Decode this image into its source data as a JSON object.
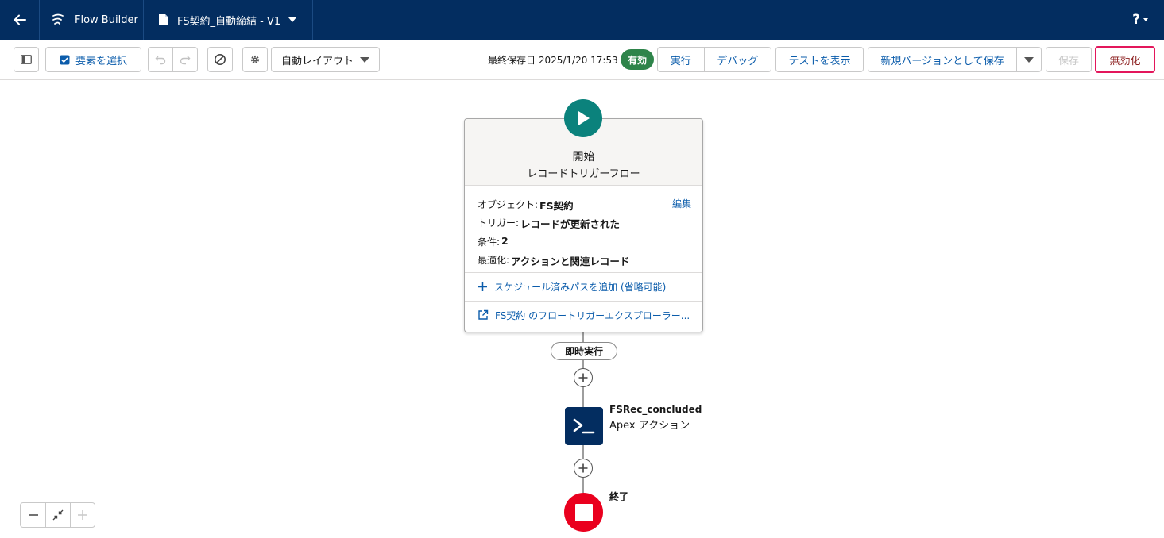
{
  "topbar": {
    "app_name": "Flow Builder",
    "flow_title": "FS契約_自動締結 - V1",
    "help_label": "?"
  },
  "toolbar": {
    "select_elements_label": "要素を選択",
    "layout_label": "自動レイアウト",
    "last_saved": "最終保存日 2025/1/20 17:53",
    "status_badge": "有効",
    "run_label": "実行",
    "debug_label": "デバッグ",
    "view_tests_label": "テストを表示",
    "save_as_new_label": "新規バージョンとして保存",
    "save_label": "保存",
    "deactivate_label": "無効化"
  },
  "start_node": {
    "title": "開始",
    "subtitle": "レコードトリガーフロー",
    "edit_label": "編集",
    "object_label": "オブジェクト:",
    "object_value": "FS契約",
    "trigger_label": "トリガー:",
    "trigger_value": "レコードが更新された",
    "conditions_label": "条件:",
    "conditions_value": "2",
    "optimize_label": "最適化:",
    "optimize_value": "アクションと関連レコード",
    "add_scheduled_path": "スケジュール済みパスを追加 (省略可能)",
    "explorer_link": "FS契約 のフロートリガーエクスプローラー..."
  },
  "path_pill": "即時実行",
  "action_node": {
    "name": "FSRec_concluded",
    "type": "Apex アクション"
  },
  "end_node": {
    "label": "終了"
  },
  "colors": {
    "header_bg": "#032d60",
    "start_green": "#0b827c",
    "active_badge": "#2e844a",
    "end_red": "#ea001e",
    "link_blue": "#0b5cab",
    "deactivate_border": "#e3165b"
  }
}
